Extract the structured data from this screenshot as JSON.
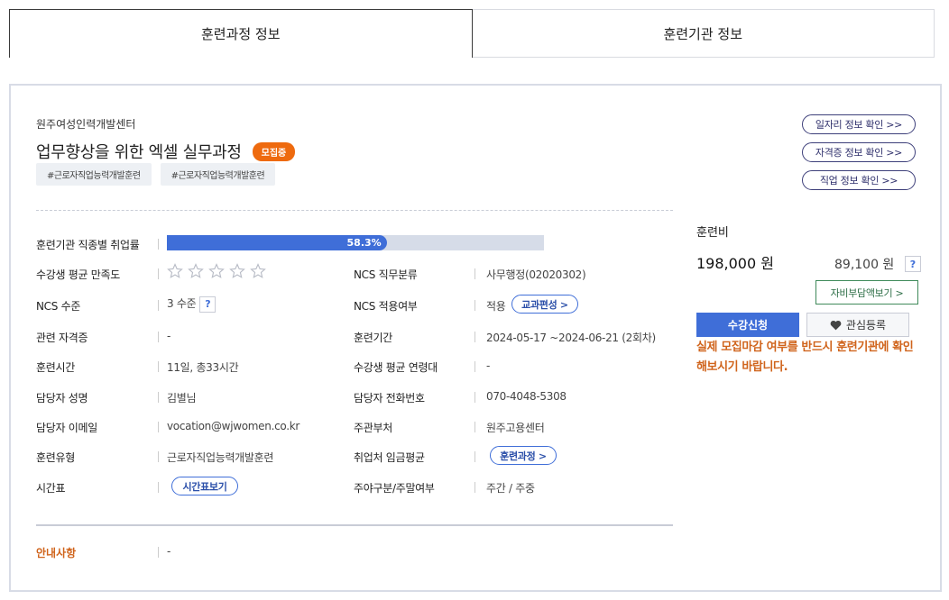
{
  "tabs": [
    {
      "label": "훈련과정 정보",
      "active": true
    },
    {
      "label": "훈련기관 정보",
      "active": false
    }
  ],
  "course": {
    "org": "원주여성인력개발센터",
    "title": "업무향상을 위한 엑셀 실무과정",
    "status_badge": "모집중",
    "tags": [
      "#근로자직업능력개발훈련",
      "#근로자직업능력개발훈련"
    ]
  },
  "links": [
    "일자리 정보 확인 >>",
    "자격증 정보 확인 >>",
    "직업 정보 확인 >>"
  ],
  "info": {
    "employment_rate_label": "훈련기관 직종별 취업률",
    "employment_rate_text": "58.3%",
    "employment_rate_value": 58.3,
    "satisfaction_label": "수강생 평균 만족도",
    "satisfaction_stars": 0,
    "satisfaction_stars_max": 5,
    "ncs_job_label": "NCS 직무분류",
    "ncs_job_value": "사무행정(02020302)",
    "ncs_level_label": "NCS 수준",
    "ncs_level_value": "3 수준",
    "ncs_apply_label": "NCS 적용여부",
    "ncs_apply_value": "적용",
    "curriculum_btn": "교과편성 >",
    "cert_label": "관련 자격증",
    "cert_value": "-",
    "period_label": "훈련기간",
    "period_value": "2024-05-17 ~2024-06-21 (2회차)",
    "hours_label": "훈련시간",
    "hours_value": "11일, 총33시간",
    "age_label": "수강생 평균 연령대",
    "age_value": "-",
    "manager_label": "담당자 성명",
    "manager_value": "김별님",
    "phone_label": "담당자 전화번호",
    "phone_value": "070-4048-5308",
    "email_label": "담당자 이메일",
    "email_value": "vocation@wjwomen.co.kr",
    "dept_label": "주관부처",
    "dept_value": "원주고용센터",
    "type_label": "훈련유형",
    "type_value": "근로자직업능력개발훈련",
    "wage_label": "취업처 임금평균",
    "wage_btn": "훈련과정 >",
    "schedule_label": "시간표",
    "schedule_btn": "시간표보기",
    "daynight_label": "주야구분/주말여부",
    "daynight_value": "주간 / 주중",
    "notice_label": "안내사항",
    "notice_value": "-"
  },
  "fee": {
    "label": "훈련비",
    "amount": "198,000 원",
    "self_amount": "89,100 원",
    "help": "?",
    "self_btn": "자비부담액보기 >",
    "apply_btn": "수강신청",
    "fav_btn": "관심등록",
    "warning": "실제 모집마감 여부를 반드시 훈련기관에 확인해보시기 바랍니다."
  },
  "colors": {
    "accent": "#3f6ed8",
    "badge": "#ee6a0e",
    "warning": "#d0641c"
  }
}
